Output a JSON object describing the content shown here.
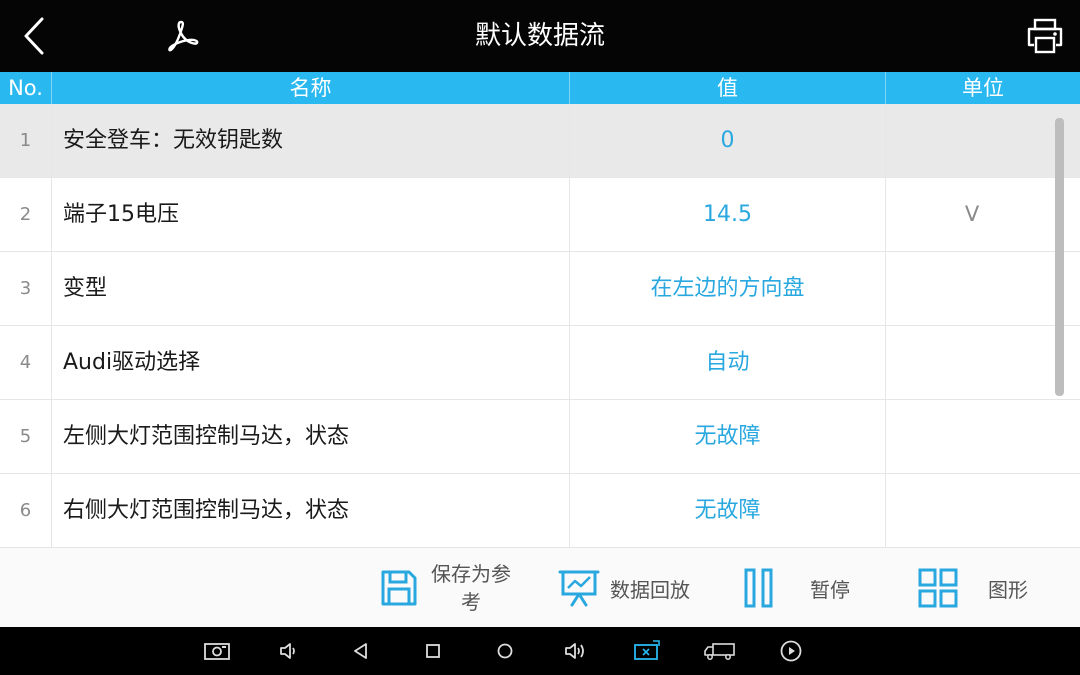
{
  "header": {
    "title": "默认数据流",
    "back_icon": "back-arrow-icon",
    "pdf_icon": "pdf-icon",
    "print_icon": "printer-icon"
  },
  "table": {
    "columns": [
      "No.",
      "名称",
      "值",
      "单位"
    ],
    "rows": [
      {
        "no": "1",
        "name": "安全登车：无效钥匙数",
        "value": "0",
        "unit": ""
      },
      {
        "no": "2",
        "name": "端子15电压",
        "value": "14.5",
        "unit": "V"
      },
      {
        "no": "3",
        "name": "变型",
        "value": "在左边的方向盘",
        "unit": ""
      },
      {
        "no": "4",
        "name": "Audi驱动选择",
        "value": "自动",
        "unit": ""
      },
      {
        "no": "5",
        "name": "左侧大灯范围控制马达，状态",
        "value": "无故障",
        "unit": ""
      },
      {
        "no": "6",
        "name": "右侧大灯范围控制马达，状态",
        "value": "无故障",
        "unit": ""
      }
    ]
  },
  "toolbar": {
    "save_line1": "保存为参",
    "save_line2": "考",
    "replay_label": "数据回放",
    "pause_label": "暂停",
    "graph_label": "图形"
  },
  "colors": {
    "header_bg": "#050505",
    "accent": "#29b8ef",
    "value_text": "#29a8e0",
    "selected_row": "#e9e9e9"
  },
  "system_bar_icons": [
    "screenshot-icon",
    "volume-down-icon",
    "nav-back-icon",
    "nav-recent-icon",
    "nav-home-icon",
    "volume-up-icon",
    "vci-connection-icon",
    "truck-icon",
    "play-icon"
  ]
}
